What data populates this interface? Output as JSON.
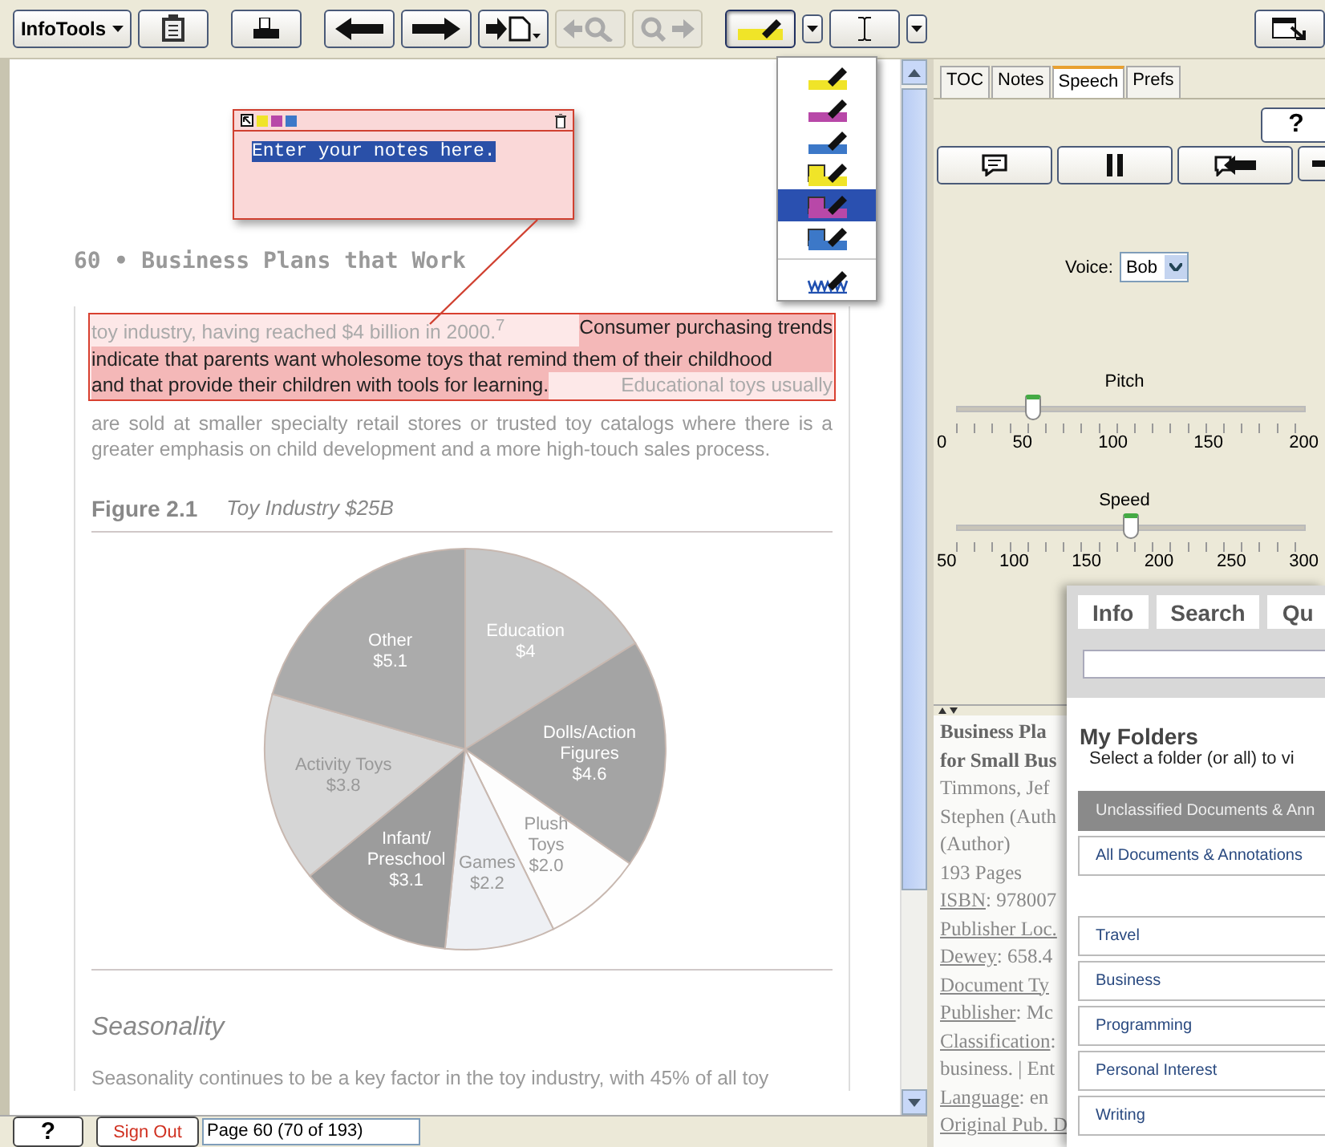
{
  "toolbar": {
    "menu_button": "InfoTools",
    "buttons": [
      {
        "kind": "clipboard",
        "disabled": false,
        "pressed": false,
        "split_menu": false
      },
      {
        "kind": "print",
        "disabled": false,
        "pressed": false,
        "split_menu": false
      },
      {
        "kind": "back",
        "disabled": false,
        "pressed": false,
        "split_menu": false
      },
      {
        "kind": "forward",
        "disabled": false,
        "pressed": false,
        "split_menu": false
      },
      {
        "kind": "import",
        "disabled": false,
        "pressed": false,
        "split_menu": false
      },
      {
        "kind": "search-back",
        "disabled": true,
        "pressed": false,
        "split_menu": false
      },
      {
        "kind": "search-forward",
        "disabled": true,
        "pressed": false,
        "split_menu": false
      },
      {
        "kind": "highlighter",
        "disabled": false,
        "pressed": true,
        "split_menu": true
      },
      {
        "kind": "text-select",
        "disabled": false,
        "pressed": false,
        "split_menu": true
      }
    ],
    "right_buttons": [
      {
        "kind": "restore",
        "disabled": false,
        "pressed": false,
        "split_menu": false
      }
    ]
  },
  "highlight_menu": {
    "items": [
      {
        "kind": "highlight",
        "color": "#f0e428",
        "selected": false
      },
      {
        "kind": "highlight",
        "color": "#b848a8",
        "selected": false
      },
      {
        "kind": "highlight",
        "color": "#3c78c8",
        "selected": false
      },
      {
        "kind": "note",
        "color": "#f0e428",
        "selected": false
      },
      {
        "kind": "note",
        "color": "#b848a8",
        "selected": true
      },
      {
        "kind": "note",
        "color": "#3c78c8",
        "selected": false
      },
      {
        "kind": "link",
        "color": "#2050b0",
        "selected": false
      }
    ]
  },
  "note": {
    "colors": [
      {
        "color": "#f0e428"
      },
      {
        "color": "#b848a8"
      },
      {
        "color": "#3c78c8"
      }
    ],
    "text": "Enter your notes here.",
    "text_selected": true
  },
  "document": {
    "page_header": "60 • Business Plans that Work",
    "annotated_passage": {
      "lines": [
        {
          "segments": [
            {
              "text": "toy industry, having reached $4 billion in 2000.$^{7}$",
              "highlighted": false
            },
            {
              "text": "Consumer purchasing trends",
              "highlighted": true
            }
          ]
        },
        {
          "segments": [
            {
              "text": "indicate that parents want wholesome toys that remind them of their childhood",
              "highlighted": true
            }
          ]
        },
        {
          "segments": [
            {
              "text": "and that provide their children with tools for learning.",
              "highlighted": true
            },
            {
              "text": "Educational toys usually",
              "highlighted": false
            }
          ]
        }
      ]
    },
    "paragraph": "are sold at smaller specialty retail stores or trusted toy catalogs where there is a greater emphasis on child development and a more high-touch sales process.",
    "figure": {
      "label": "Figure 2.1",
      "title": "Toy Industry $25B",
      "chart_data": {
        "type": "pie",
        "categories": [
          "Education",
          "Dolls/Action\nFigures",
          "Plush\nToys",
          "Games",
          "Infant/\nPreschool",
          "Activity Toys",
          "Other"
        ],
        "values": [
          4,
          4.6,
          2.0,
          2.2,
          3.1,
          3.8,
          5.1
        ],
        "value_labels": [
          "$4",
          "$4.6",
          "$2.0",
          "$2.2",
          "$3.1",
          "$3.8",
          "$5.1"
        ]
      }
    },
    "section_heading": "Seasonality",
    "section_text": "Seasonality continues to be a key factor in the toy industry, with 45% of all toy"
  },
  "side_tabs": [
    {
      "label": "TOC",
      "selected": false
    },
    {
      "label": "Notes",
      "selected": false
    },
    {
      "label": "Speech",
      "selected": true
    },
    {
      "label": "Prefs",
      "selected": false
    }
  ],
  "speech": {
    "help_button": "?",
    "buttons": [
      {
        "kind": "speak"
      },
      {
        "kind": "pause"
      },
      {
        "kind": "speak-back"
      },
      {
        "kind": "next"
      }
    ],
    "voice_label": "Voice:",
    "voice_value": "Bob",
    "sliders": [
      {
        "label": "Pitch",
        "level": 0.22,
        "ticks": [
          "0",
          "50",
          "100",
          "150",
          "200"
        ]
      },
      {
        "label": "Speed",
        "level": 0.5,
        "ticks": [
          "50",
          "100",
          "150",
          "200",
          "250",
          "300"
        ]
      }
    ]
  },
  "book_info": {
    "lines": [
      {
        "kind": "title",
        "text": "Business Pla"
      },
      {
        "kind": "title",
        "text": "for Small Bus"
      },
      {
        "kind": "plain",
        "text": "Timmons, Jef"
      },
      {
        "kind": "plain",
        "text": "Stephen (Auth"
      },
      {
        "kind": "plain",
        "text": "(Author)"
      },
      {
        "kind": "plain",
        "text": "193 Pages"
      },
      {
        "kind": "field",
        "link": "ISBN",
        "text": ": 978007"
      },
      {
        "kind": "field",
        "link": "Publisher Loc."
      },
      {
        "kind": "field",
        "link": "Dewey",
        "text": ": 658.4"
      },
      {
        "kind": "field",
        "link": "Document Ty"
      },
      {
        "kind": "field",
        "link": "Publisher",
        "text": ": Mc"
      },
      {
        "kind": "field",
        "link": "Classification",
        "text": ":"
      },
      {
        "kind": "plain",
        "text": "business. | Ent"
      },
      {
        "kind": "field",
        "link": "Language",
        "text": ": en"
      },
      {
        "kind": "field",
        "link": "Original Pub. D"
      }
    ]
  },
  "folders_panel": {
    "tabs": [
      "Info",
      "Search",
      "Qu"
    ],
    "heading": "My Folders",
    "subtitle": "Select a folder (or all) to vi",
    "special_folders": [
      {
        "label": "Unclassified Documents & Ann",
        "selected": true
      },
      {
        "label": "All Documents & Annotations",
        "selected": false
      }
    ],
    "folders": [
      {
        "label": "Travel",
        "selected": false
      },
      {
        "label": "Business",
        "selected": false
      },
      {
        "label": "Programming",
        "selected": false
      },
      {
        "label": "Personal Interest",
        "selected": false
      },
      {
        "label": "Writing",
        "selected": false
      }
    ]
  },
  "bottom_bar": {
    "help_button": "?",
    "sign_out": "Sign Out",
    "page_field": "Page 60 (70 of 193)"
  }
}
